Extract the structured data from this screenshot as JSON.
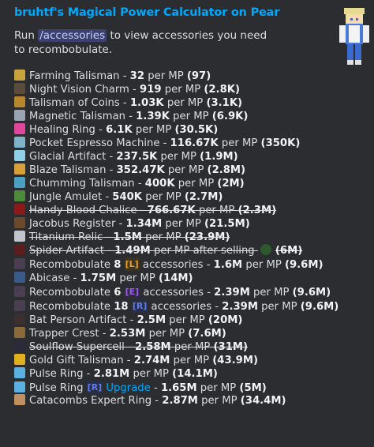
{
  "embed": {
    "title": "bruhtf's Magical Power Calculator on Pear",
    "desc_prefix": "Run",
    "command": "/accessories",
    "desc_suffix": "to view accessories you need to recombobulate.",
    "avatar_icon": "minecraft-skin-avatar"
  },
  "rows": [
    {
      "icon": "farming-talisman-icon",
      "color": "#c9a23c",
      "name": "Farming Talisman",
      "sep": " - ",
      "val": "32",
      "per": " per MP ",
      "paren": "(97)",
      "strike": false
    },
    {
      "icon": "night-vision-charm-icon",
      "color": "#5c4a3a",
      "name": "Night Vision Charm",
      "sep": " - ",
      "val": "919",
      "per": " per MP ",
      "paren": "(2.8K)",
      "strike": false
    },
    {
      "icon": "talisman-of-coins-icon",
      "color": "#b8862e",
      "name": "Talisman of Coins",
      "sep": " - ",
      "val": "1.03K",
      "per": " per MP ",
      "paren": "(3.1K)",
      "strike": false
    },
    {
      "icon": "magnetic-talisman-icon",
      "color": "#9aa3b0",
      "name": "Magnetic Talisman",
      "sep": " - ",
      "val": "1.39K",
      "per": " per MP ",
      "paren": "(6.9K)",
      "strike": false
    },
    {
      "icon": "healing-ring-icon",
      "color": "#e0479c",
      "name": "Healing Ring",
      "sep": " - ",
      "val": "6.1K",
      "per": " per MP ",
      "paren": "(30.5K)",
      "strike": false
    },
    {
      "icon": "pocket-espresso-machine-icon",
      "color": "#7fb3c8",
      "name": "Pocket Espresso Machine",
      "sep": " - ",
      "val": "116.67K",
      "per": " per MP ",
      "paren": "(350K)",
      "strike": false
    },
    {
      "icon": "glacial-artifact-icon",
      "color": "#8fd0e8",
      "name": "Glacial Artifact",
      "sep": " - ",
      "val": "237.5K",
      "per": " per MP ",
      "paren": "(1.9M)",
      "strike": false
    },
    {
      "icon": "blaze-talisman-icon",
      "color": "#d9a03a",
      "name": "Blaze Talisman",
      "sep": " - ",
      "val": "352.47K",
      "per": " per MP ",
      "paren": "(2.8M)",
      "strike": false
    },
    {
      "icon": "chumming-talisman-icon",
      "color": "#4aa0c0",
      "name": "Chumming Talisman",
      "sep": " - ",
      "val": "400K",
      "per": " per MP ",
      "paren": "(2M)",
      "strike": false
    },
    {
      "icon": "jungle-amulet-icon",
      "color": "#4d8a3a",
      "name": "Jungle Amulet",
      "sep": " - ",
      "val": "540K",
      "per": " per MP ",
      "paren": "(2.7M)",
      "strike": false
    },
    {
      "icon": "handy-blood-chalice-icon",
      "color": "#8a1a1a",
      "name": "Handy Blood Chalice",
      "sep": " - ",
      "val": "766.67K",
      "per": " per MP ",
      "paren": "(2.3M)",
      "strike": true
    },
    {
      "icon": "jacobus-register-icon",
      "color": "#6a4a2a",
      "name": "Jacobus Register",
      "sep": " - ",
      "val": "1.34M",
      "per": " per MP ",
      "paren": "(21.5M)",
      "strike": false
    },
    {
      "icon": "titanium-relic-icon",
      "color": "#c0c4cc",
      "name": "Titanium Relic",
      "sep": " - ",
      "val": "1.5M",
      "per": " per MP ",
      "paren": "(23.9M)",
      "strike": true
    }
  ],
  "spider": {
    "icon": "spider-artifact-icon",
    "color": "#5a1e1e",
    "name": "Spider Artifact",
    "sep": " - ",
    "val": "1.49M",
    "per": " per MP after selling ",
    "paren": "(6M)",
    "extra_icon": "spider-eye-icon",
    "extra_color": "#2d5a2d"
  },
  "recomb1": {
    "icon": "recombobulate-icon",
    "color": "#4a3f50",
    "prefix": "Recombobulate ",
    "count": "8",
    "tag": "[L]",
    "tag_color": "#f0a020",
    "mid": " accessories",
    "sep": " - ",
    "val": "1.6M",
    "per": " per MP ",
    "paren": "(9.6M)"
  },
  "abicase": {
    "icon": "abicase-icon",
    "color": "#3a5a8a",
    "name": "Abicase",
    "sep": " - ",
    "val": "1.75M",
    "per": " per MP ",
    "paren": "(14M)"
  },
  "recomb2": {
    "icon": "recombobulate-icon",
    "color": "#4a3f50",
    "prefix": "Recombobulate ",
    "count": "6",
    "tag": "[E]",
    "tag_color": "#9c5cf0",
    "mid": " accessories",
    "sep": " - ",
    "val": "2.39M",
    "per": " per MP ",
    "paren": "(9.6M)"
  },
  "recomb3": {
    "icon": "recombobulate-icon",
    "color": "#4a3f50",
    "prefix": "Recombobulate ",
    "count": "18",
    "tag": "[R]",
    "tag_color": "#5c7cf0",
    "mid": " accessories",
    "sep": " - ",
    "val": "2.39M",
    "per": " per MP ",
    "paren": "(9.6M)"
  },
  "rows2": [
    {
      "icon": "bat-person-artifact-icon",
      "color": "#3a3030",
      "name": "Bat Person Artifact",
      "sep": " - ",
      "val": "2.5M",
      "per": " per MP ",
      "paren": "(20M)",
      "strike": false
    },
    {
      "icon": "trapper-crest-icon",
      "color": "#8a6a3a",
      "name": "Trapper Crest",
      "sep": " - ",
      "val": "2.53M",
      "per": " per MP ",
      "paren": "(7.6M)",
      "strike": false
    },
    {
      "icon": "soulflow-supercell-icon",
      "color": "#2a2a3a",
      "name": "Soulflow Supercell",
      "sep": " - ",
      "val": "2.58M",
      "per": " per MP ",
      "paren": "(31M)",
      "strike": true
    },
    {
      "icon": "gold-gift-talisman-icon",
      "color": "#e0b020",
      "name": "Gold Gift Talisman",
      "sep": " - ",
      "val": "2.74M",
      "per": " per MP ",
      "paren": "(43.9M)",
      "strike": false
    },
    {
      "icon": "pulse-ring-icon",
      "color": "#5ab0e0",
      "name": "Pulse Ring",
      "sep": " - ",
      "val": "2.81M",
      "per": " per MP ",
      "paren": "(14.1M)",
      "strike": false
    }
  ],
  "pulse_upgrade": {
    "icon": "pulse-ring-icon",
    "color": "#5ab0e0",
    "name": "Pulse Ring ",
    "tag": "[R]",
    "tag_color": "#5c7cf0",
    "upgrade": " Upgrade",
    "sep": " - ",
    "val": "1.65M",
    "per": " per MP ",
    "paren": "(5M)"
  },
  "catacombs": {
    "icon": "catacombs-expert-ring-icon",
    "color": "#c09060",
    "name": "Catacombs Expert Ring",
    "sep": " - ",
    "val": "2.87M",
    "per": " per MP ",
    "paren": "(34.4M)"
  }
}
